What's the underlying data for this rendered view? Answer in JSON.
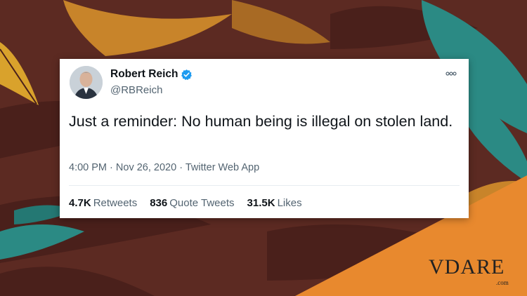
{
  "tweet": {
    "display_name": "Robert Reich",
    "handle": "@RBReich",
    "text": "Just a reminder: No human being is illegal on stolen land.",
    "time": "4:00 PM",
    "date": "Nov 26, 2020",
    "source": "Twitter Web App",
    "separator": "·",
    "stats": {
      "retweets_count": "4.7K",
      "retweets_label": "Retweets",
      "quotes_count": "836",
      "quotes_label": "Quote Tweets",
      "likes_count": "31.5K",
      "likes_label": "Likes"
    }
  },
  "watermark": {
    "logo_text": "VDARE",
    "logo_suffix": ".com"
  },
  "icons": {
    "verified": "verified-badge-icon",
    "more": "more-options-icon"
  },
  "colors": {
    "background": "#5c2a22",
    "feather_orange": "#c8842a",
    "feather_teal": "#2b8a84",
    "feather_dark": "#4a201b",
    "verified_blue": "#1d9bf0",
    "corner_orange": "#e8892e"
  }
}
